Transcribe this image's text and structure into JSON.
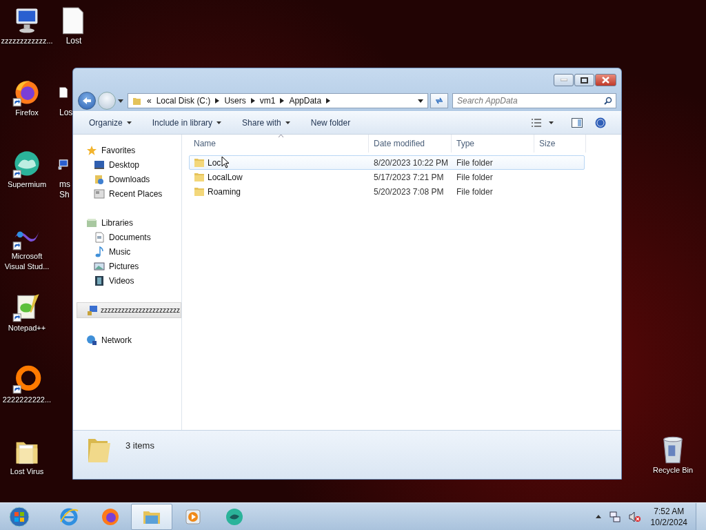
{
  "desktop": {
    "column_1": [
      {
        "kind": "monitor",
        "lines": [
          "zzzzzzzzzzzz..."
        ],
        "shortcut": false
      },
      {
        "kind": "firefox",
        "lines": [
          "Firefox"
        ],
        "shortcut": true
      },
      {
        "kind": "supermium",
        "lines": [
          "Supermium"
        ],
        "shortcut": true
      },
      {
        "kind": "visualstudio",
        "lines": [
          "Microsoft",
          "Visual Stud..."
        ],
        "shortcut": true
      },
      {
        "kind": "notepad",
        "lines": [
          "Notepad++"
        ],
        "shortcut": true
      },
      {
        "kind": "ring",
        "lines": [
          "2222222222..."
        ],
        "shortcut": true
      },
      {
        "kind": "folder",
        "lines": [
          "Lost Virus"
        ],
        "shortcut": false
      }
    ],
    "column_2": [
      {
        "kind": "file",
        "lines": [
          "Lost"
        ],
        "shortcut": false
      },
      {
        "kind": "file",
        "lines": [
          "Los"
        ],
        "shortcut": false
      },
      {
        "kind": "monitor",
        "lines": [
          "ms",
          "Sh"
        ],
        "shortcut": true
      }
    ],
    "recycle_bin": {
      "label": "Recycle Bin"
    }
  },
  "window": {
    "address": {
      "overflow": "«",
      "crumbs": [
        "Local Disk (C:)",
        "Users",
        "vm1",
        "AppData"
      ]
    },
    "search": {
      "placeholder": "Search AppData"
    },
    "toolbar": [
      {
        "label": "Organize",
        "dropdown": true
      },
      {
        "label": "Include in library",
        "dropdown": true
      },
      {
        "label": "Share with",
        "dropdown": true
      },
      {
        "label": "New folder",
        "dropdown": false
      }
    ],
    "nav": [
      {
        "label": "Favorites",
        "kind": "star",
        "selected": false,
        "children": [
          {
            "label": "Desktop",
            "kind": "desktop",
            "selected": false
          },
          {
            "label": "Downloads",
            "kind": "downloads",
            "selected": false
          },
          {
            "label": "Recent Places",
            "kind": "recent",
            "selected": false
          }
        ]
      },
      {
        "label": "Libraries",
        "kind": "library",
        "selected": false,
        "children": [
          {
            "label": "Documents",
            "kind": "documents",
            "selected": false
          },
          {
            "label": "Music",
            "kind": "music",
            "selected": false
          },
          {
            "label": "Pictures",
            "kind": "pictures",
            "selected": false
          },
          {
            "label": "Videos",
            "kind": "videos",
            "selected": false
          }
        ]
      },
      {
        "label": "zzzzzzzzzzzzzzzzzzzzzzz",
        "kind": "computer",
        "selected": true
      },
      {
        "label": "Network",
        "kind": "network",
        "selected": false
      }
    ],
    "table": {
      "columns": [
        "Name",
        "Date modified",
        "Type",
        "Size"
      ],
      "rows": [
        {
          "name": "Loc",
          "date": "8/20/2023 10:22 PM",
          "type": "File folder",
          "hovered": true
        },
        {
          "name": "LocalLow",
          "date": "5/17/2023 7:21 PM",
          "type": "File folder",
          "hovered": false
        },
        {
          "name": "Roaming",
          "date": "5/20/2023 7:08 PM",
          "type": "File folder",
          "hovered": false
        }
      ]
    },
    "status_bar": {
      "count": "3 items"
    }
  },
  "taskbar": {
    "items": [
      {
        "kind": "ie",
        "selected": false
      },
      {
        "kind": "firefox",
        "selected": false
      },
      {
        "kind": "explorer",
        "selected": true
      },
      {
        "kind": "media",
        "selected": false
      },
      {
        "kind": "supermium",
        "selected": false
      }
    ],
    "time": "7:52 AM",
    "date": "10/2/2024"
  }
}
